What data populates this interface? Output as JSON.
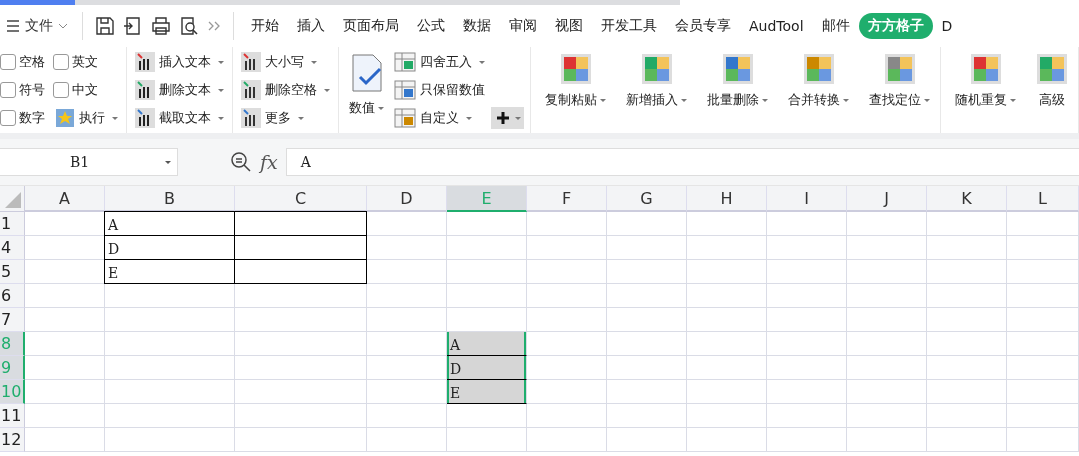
{
  "menu": {
    "file_label": "文件",
    "tabs": [
      {
        "label": "开始",
        "selected": false
      },
      {
        "label": "插入",
        "selected": false
      },
      {
        "label": "页面布局",
        "selected": false
      },
      {
        "label": "公式",
        "selected": false
      },
      {
        "label": "数据",
        "selected": false
      },
      {
        "label": "审阅",
        "selected": false
      },
      {
        "label": "视图",
        "selected": false
      },
      {
        "label": "开发工具",
        "selected": false
      },
      {
        "label": "会员专享",
        "selected": false
      },
      {
        "label": "AudTool",
        "selected": false
      },
      {
        "label": "邮件",
        "selected": false
      },
      {
        "label": "方方格子",
        "selected": true
      },
      {
        "label": "D",
        "selected": false
      }
    ]
  },
  "ribbon": [
    {
      "kind": "checks",
      "items": [
        {
          "label": "空格",
          "checked": false
        },
        {
          "label": "英文",
          "checked": false
        },
        {
          "label": "符号",
          "checked": false
        },
        {
          "label": "中文",
          "checked": false
        },
        {
          "label": "数字",
          "checked": false
        }
      ],
      "action": {
        "label": "执行",
        "dropdown": true
      }
    },
    {
      "kind": "list",
      "items": [
        {
          "label": "插入文本",
          "dropdown": true
        },
        {
          "label": "删除文本",
          "dropdown": true
        },
        {
          "label": "截取文本",
          "dropdown": true
        }
      ]
    },
    {
      "kind": "list",
      "items": [
        {
          "label": "大小写",
          "dropdown": true
        },
        {
          "label": "删除空格",
          "dropdown": true
        },
        {
          "label": "更多",
          "dropdown": true
        }
      ]
    },
    {
      "kind": "mixed",
      "large": {
        "label": "数值",
        "dropdown": true
      },
      "items": [
        {
          "label": "四舍五入",
          "dropdown": true
        },
        {
          "label": "只保留数值",
          "dropdown": false
        },
        {
          "label": "自定义",
          "dropdown": true
        }
      ]
    },
    {
      "kind": "large",
      "items": [
        {
          "label": "复制粘贴",
          "dropdown": true
        },
        {
          "label": "新增插入",
          "dropdown": true
        },
        {
          "label": "批量删除",
          "dropdown": true
        },
        {
          "label": "合并转换",
          "dropdown": true
        },
        {
          "label": "查找定位",
          "dropdown": true
        }
      ]
    },
    {
      "kind": "large",
      "items": [
        {
          "label": "随机重复",
          "dropdown": true
        },
        {
          "label": "高级",
          "dropdown": false
        }
      ]
    }
  ],
  "formula_bar": {
    "name_box": "B1",
    "function_label": "fx",
    "value": "A"
  },
  "sheet": {
    "columns": [
      {
        "label": "A",
        "selected": false
      },
      {
        "label": "B",
        "selected": false
      },
      {
        "label": "C",
        "selected": false
      },
      {
        "label": "D",
        "selected": false
      },
      {
        "label": "E",
        "selected": true
      },
      {
        "label": "F",
        "selected": false
      },
      {
        "label": "G",
        "selected": false
      },
      {
        "label": "H",
        "selected": false
      },
      {
        "label": "I",
        "selected": false
      },
      {
        "label": "J",
        "selected": false
      },
      {
        "label": "K",
        "selected": false
      },
      {
        "label": "L",
        "selected": false
      }
    ],
    "rows": [
      {
        "label": "1",
        "selected": false,
        "cells": [
          {
            "bordered": false,
            "selected": false
          },
          {
            "value": "A",
            "bordered": true,
            "selected": false
          },
          {
            "bordered": true,
            "selected": false
          },
          {
            "bordered": false,
            "selected": false
          },
          {
            "bordered": false,
            "selected": false
          },
          {
            "bordered": false,
            "selected": false
          },
          {
            "bordered": false,
            "selected": false
          },
          {
            "bordered": false,
            "selected": false
          },
          {
            "bordered": false,
            "selected": false
          },
          {
            "bordered": false,
            "selected": false
          },
          {
            "bordered": false,
            "selected": false
          },
          {
            "bordered": false,
            "selected": false
          }
        ]
      },
      {
        "label": "4",
        "selected": false,
        "cells": [
          {
            "bordered": false,
            "selected": false
          },
          {
            "value": "D",
            "bordered": true,
            "selected": false
          },
          {
            "bordered": true,
            "selected": false
          },
          {
            "bordered": false,
            "selected": false
          },
          {
            "bordered": false,
            "selected": false
          },
          {
            "bordered": false,
            "selected": false
          },
          {
            "bordered": false,
            "selected": false
          },
          {
            "bordered": false,
            "selected": false
          },
          {
            "bordered": false,
            "selected": false
          },
          {
            "bordered": false,
            "selected": false
          },
          {
            "bordered": false,
            "selected": false
          },
          {
            "bordered": false,
            "selected": false
          }
        ]
      },
      {
        "label": "5",
        "selected": false,
        "cells": [
          {
            "bordered": false,
            "selected": false
          },
          {
            "value": "E",
            "bordered": true,
            "selected": false
          },
          {
            "bordered": true,
            "selected": false
          },
          {
            "bordered": false,
            "selected": false
          },
          {
            "bordered": false,
            "selected": false
          },
          {
            "bordered": false,
            "selected": false
          },
          {
            "bordered": false,
            "selected": false
          },
          {
            "bordered": false,
            "selected": false
          },
          {
            "bordered": false,
            "selected": false
          },
          {
            "bordered": false,
            "selected": false
          },
          {
            "bordered": false,
            "selected": false
          },
          {
            "bordered": false,
            "selected": false
          }
        ]
      },
      {
        "label": "6",
        "selected": false,
        "cells": [
          {
            "bordered": false,
            "selected": false
          },
          {
            "bordered": false,
            "selected": false
          },
          {
            "bordered": false,
            "selected": false
          },
          {
            "bordered": false,
            "selected": false
          },
          {
            "bordered": false,
            "selected": false
          },
          {
            "bordered": false,
            "selected": false
          },
          {
            "bordered": false,
            "selected": false
          },
          {
            "bordered": false,
            "selected": false
          },
          {
            "bordered": false,
            "selected": false
          },
          {
            "bordered": false,
            "selected": false
          },
          {
            "bordered": false,
            "selected": false
          },
          {
            "bordered": false,
            "selected": false
          }
        ]
      },
      {
        "label": "7",
        "selected": false,
        "cells": [
          {
            "bordered": false,
            "selected": false
          },
          {
            "bordered": false,
            "selected": false
          },
          {
            "bordered": false,
            "selected": false
          },
          {
            "bordered": false,
            "selected": false
          },
          {
            "bordered": false,
            "selected": false
          },
          {
            "bordered": false,
            "selected": false
          },
          {
            "bordered": false,
            "selected": false
          },
          {
            "bordered": false,
            "selected": false
          },
          {
            "bordered": false,
            "selected": false
          },
          {
            "bordered": false,
            "selected": false
          },
          {
            "bordered": false,
            "selected": false
          },
          {
            "bordered": false,
            "selected": false
          }
        ]
      },
      {
        "label": "8",
        "selected": true,
        "cells": [
          {
            "bordered": false,
            "selected": false
          },
          {
            "bordered": false,
            "selected": false
          },
          {
            "bordered": false,
            "selected": false
          },
          {
            "bordered": false,
            "selected": false
          },
          {
            "value": "A",
            "bordered": false,
            "selected": true
          },
          {
            "bordered": false,
            "selected": false
          },
          {
            "bordered": false,
            "selected": false
          },
          {
            "bordered": false,
            "selected": false
          },
          {
            "bordered": false,
            "selected": false
          },
          {
            "bordered": false,
            "selected": false
          },
          {
            "bordered": false,
            "selected": false
          },
          {
            "bordered": false,
            "selected": false
          }
        ]
      },
      {
        "label": "9",
        "selected": true,
        "cells": [
          {
            "bordered": false,
            "selected": false
          },
          {
            "bordered": false,
            "selected": false
          },
          {
            "bordered": false,
            "selected": false
          },
          {
            "bordered": false,
            "selected": false
          },
          {
            "value": "D",
            "bordered": false,
            "selected": true
          },
          {
            "bordered": false,
            "selected": false
          },
          {
            "bordered": false,
            "selected": false
          },
          {
            "bordered": false,
            "selected": false
          },
          {
            "bordered": false,
            "selected": false
          },
          {
            "bordered": false,
            "selected": false
          },
          {
            "bordered": false,
            "selected": false
          },
          {
            "bordered": false,
            "selected": false
          }
        ]
      },
      {
        "label": "10",
        "selected": true,
        "cells": [
          {
            "bordered": false,
            "selected": false
          },
          {
            "bordered": false,
            "selected": false
          },
          {
            "bordered": false,
            "selected": false
          },
          {
            "bordered": false,
            "selected": false
          },
          {
            "value": "E",
            "bordered": false,
            "selected": true
          },
          {
            "bordered": false,
            "selected": false
          },
          {
            "bordered": false,
            "selected": false
          },
          {
            "bordered": false,
            "selected": false
          },
          {
            "bordered": false,
            "selected": false
          },
          {
            "bordered": false,
            "selected": false
          },
          {
            "bordered": false,
            "selected": false
          },
          {
            "bordered": false,
            "selected": false
          }
        ]
      },
      {
        "label": "11",
        "selected": false,
        "cells": [
          {
            "bordered": false,
            "selected": false
          },
          {
            "bordered": false,
            "selected": false
          },
          {
            "bordered": false,
            "selected": false
          },
          {
            "bordered": false,
            "selected": false
          },
          {
            "bordered": false,
            "selected": false
          },
          {
            "bordered": false,
            "selected": false
          },
          {
            "bordered": false,
            "selected": false
          },
          {
            "bordered": false,
            "selected": false
          },
          {
            "bordered": false,
            "selected": false
          },
          {
            "bordered": false,
            "selected": false
          },
          {
            "bordered": false,
            "selected": false
          },
          {
            "bordered": false,
            "selected": false
          }
        ]
      },
      {
        "label": "12",
        "selected": false,
        "cells": [
          {
            "bordered": false,
            "selected": false
          },
          {
            "bordered": false,
            "selected": false
          },
          {
            "bordered": false,
            "selected": false
          },
          {
            "bordered": false,
            "selected": false
          },
          {
            "bordered": false,
            "selected": false
          },
          {
            "bordered": false,
            "selected": false
          },
          {
            "bordered": false,
            "selected": false
          },
          {
            "bordered": false,
            "selected": false
          },
          {
            "bordered": false,
            "selected": false
          },
          {
            "bordered": false,
            "selected": false
          },
          {
            "bordered": false,
            "selected": false
          },
          {
            "bordered": false,
            "selected": false
          }
        ]
      }
    ]
  }
}
